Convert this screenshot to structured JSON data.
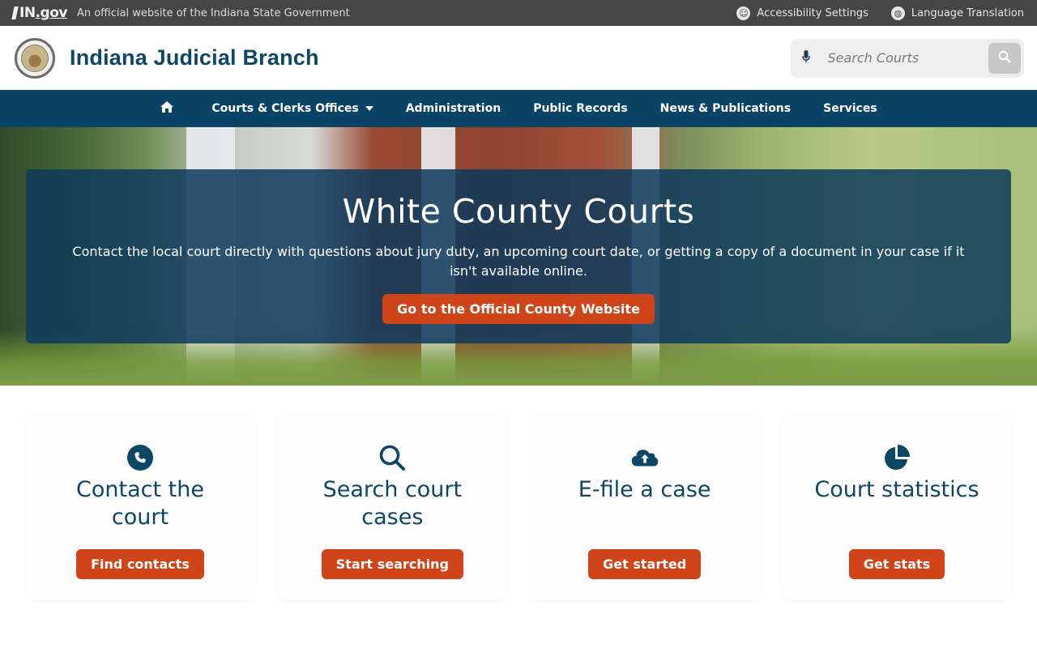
{
  "statebar": {
    "logo_text": "IN",
    "logo_gov": ".gov",
    "official_text": "An official website of the Indiana State Government",
    "accessibility_label": "Accessibility Settings",
    "language_label": "Language Translation"
  },
  "header": {
    "site_title": "Indiana Judicial Branch",
    "search_placeholder": "Search Courts"
  },
  "nav": {
    "items": [
      {
        "label": "Courts & Clerks Offices"
      },
      {
        "label": "Administration"
      },
      {
        "label": "Public Records"
      },
      {
        "label": "News & Publications"
      },
      {
        "label": "Services"
      }
    ]
  },
  "hero": {
    "title": "White County Courts",
    "description": "Contact the local court directly with questions about jury duty, an upcoming court date, or getting a copy of a document in your case if it isn't available online.",
    "cta_label": "Go to the Official County Website"
  },
  "cards": [
    {
      "title": "Contact the court",
      "button": "Find contacts",
      "icon": "phone-icon"
    },
    {
      "title": "Search court cases",
      "button": "Start searching",
      "icon": "magnifier-icon"
    },
    {
      "title": "E-file a case",
      "button": "Get started",
      "icon": "cloud-upload-icon"
    },
    {
      "title": "Court statistics",
      "button": "Get stats",
      "icon": "pie-chart-icon"
    }
  ],
  "colors": {
    "statebar": "#454545",
    "nav": "#0b4366",
    "title": "#0e4666",
    "accent": "#cf4419",
    "panel": "#0f3a5c"
  }
}
